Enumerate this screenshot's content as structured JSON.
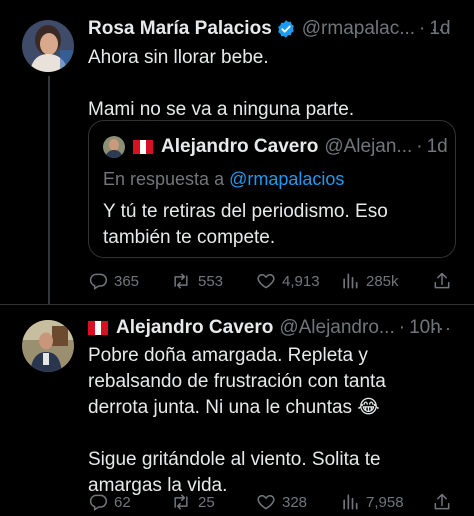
{
  "tweet1": {
    "author_name": "Rosa María Palacios",
    "handle": "@rmapalac...",
    "dot": "·",
    "time": "1d",
    "more": "···",
    "body": "Ahora sin llorar bebe.\n\nMami no se va a ninguna parte.",
    "quote": {
      "author_name": "Alejandro Cavero",
      "handle": "@Alejan...",
      "dot": "·",
      "time": "1d",
      "reply_prefix": "En respuesta a ",
      "reply_mention": "@rmapalacios",
      "body": "Y tú te retiras del periodismo. Eso\ntambién te compete."
    },
    "actions": {
      "replies": "365",
      "retweets": "553",
      "likes": "4,913",
      "views": "285k"
    }
  },
  "tweet2": {
    "author_name": "Alejandro Cavero",
    "handle": "@Alejandro...",
    "dot": "·",
    "time": "10h",
    "more": "···",
    "body": "Pobre doña amargada. Repleta y\nrebalsando de frustración con tanta\nderrota junta. Ni una le chuntas 😂\n\nSigue gritándole al viento. Solita te\namargas la vida.",
    "actions": {
      "replies": "62",
      "retweets": "25",
      "likes": "328",
      "views": "7,958"
    }
  },
  "colors": {
    "background": "#000000",
    "text": "#e7e9ea",
    "muted": "#71767b",
    "link": "#1d9bf0",
    "verified": "#1d9bf0",
    "border": "#2f3336",
    "flag_red": "#d91023"
  },
  "icons": [
    "verified-badge-icon",
    "peru-flag-icon",
    "reply-icon",
    "retweet-icon",
    "like-icon",
    "views-icon",
    "share-icon",
    "more-icon"
  ]
}
